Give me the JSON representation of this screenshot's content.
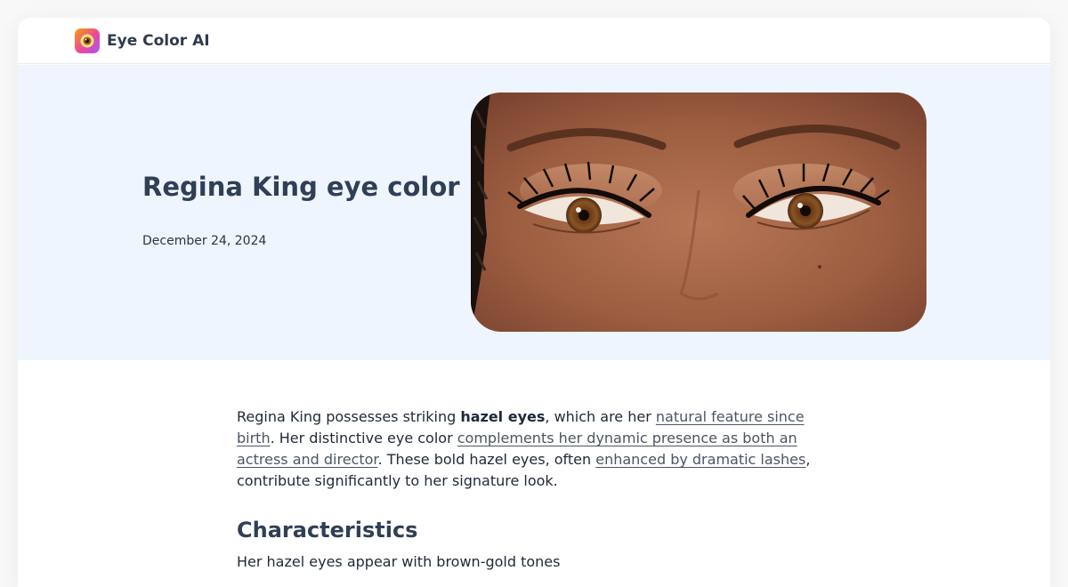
{
  "brand": {
    "name": "Eye Color AI",
    "logo_icon": "eye-icon"
  },
  "hero": {
    "title": "Regina King eye color",
    "date": "December 24, 2024",
    "image_alt": "Regina King eyes"
  },
  "article": {
    "intro": {
      "t1": "Regina King possesses striking ",
      "bold": "hazel eyes",
      "t2": ", which are her ",
      "link1": "natural feature since birth",
      "t3": ". Her distinctive eye color ",
      "link2": "complements her dynamic presence as both an actress and director",
      "t4": ". These bold hazel eyes, often ",
      "link3": "enhanced by dramatic lashes",
      "t5": ", contribute significantly to her signature look."
    },
    "section_heading": "Characteristics",
    "section_text": "Her hazel eyes appear with brown-gold tones"
  },
  "colors": {
    "page_bg": "#f8f8f9",
    "hero_bg": "#eef5ff",
    "heading": "#2f3f55",
    "link": "#4b5563"
  }
}
